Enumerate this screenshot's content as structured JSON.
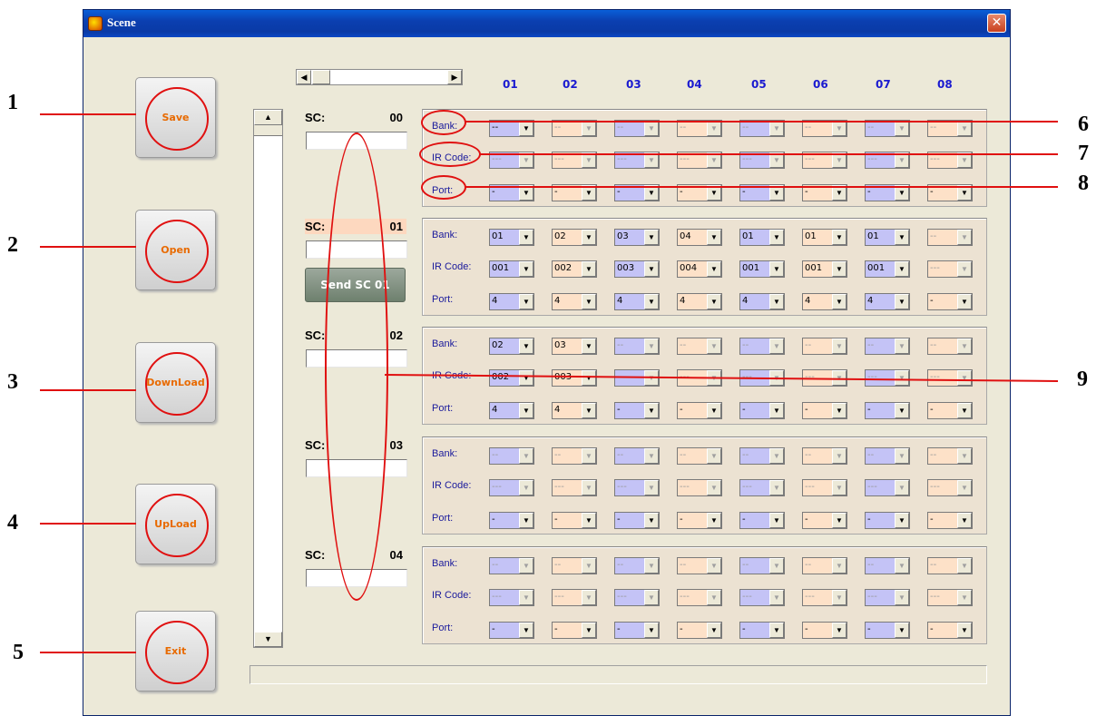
{
  "window": {
    "title": "Scene",
    "close_label": "✕"
  },
  "buttons": [
    {
      "id": "save",
      "label": "Save"
    },
    {
      "id": "open",
      "label": "Open"
    },
    {
      "id": "download",
      "label": "DownLoad"
    },
    {
      "id": "upload",
      "label": "UpLoad"
    },
    {
      "id": "exit",
      "label": "Exit"
    }
  ],
  "columns": [
    "01",
    "02",
    "03",
    "04",
    "05",
    "06",
    "07",
    "08"
  ],
  "row_labels": {
    "bank": "Bank:",
    "ir_code": "IR Code:",
    "port": "Port:"
  },
  "send_button": {
    "label": "Send SC 01"
  },
  "scenes": [
    {
      "sc_label": "SC:",
      "number": "00",
      "highlighted": false,
      "name": "",
      "bank": [
        "--",
        "--",
        "--",
        "--",
        "--",
        "--",
        "--",
        "--"
      ],
      "ir": [
        "---",
        "---",
        "---",
        "---",
        "---",
        "---",
        "---",
        "---"
      ],
      "port": [
        "-",
        "-",
        "-",
        "-",
        "-",
        "-",
        "-",
        "-"
      ]
    },
    {
      "sc_label": "SC:",
      "number": "01",
      "highlighted": true,
      "name": "",
      "bank": [
        "01",
        "02",
        "03",
        "04",
        "01",
        "01",
        "01",
        "--"
      ],
      "ir": [
        "001",
        "002",
        "003",
        "004",
        "001",
        "001",
        "001",
        "---"
      ],
      "port": [
        "4",
        "4",
        "4",
        "4",
        "4",
        "4",
        "4",
        "-"
      ]
    },
    {
      "sc_label": "SC:",
      "number": "02",
      "highlighted": false,
      "name": "",
      "bank": [
        "02",
        "03",
        "--",
        "--",
        "--",
        "--",
        "--",
        "--"
      ],
      "ir": [
        "002",
        "003",
        "---",
        "---",
        "---",
        "---",
        "---",
        "---"
      ],
      "port": [
        "4",
        "4",
        "-",
        "-",
        "-",
        "-",
        "-",
        "-"
      ]
    },
    {
      "sc_label": "SC:",
      "number": "03",
      "highlighted": false,
      "name": "",
      "bank": [
        "--",
        "--",
        "--",
        "--",
        "--",
        "--",
        "--",
        "--"
      ],
      "ir": [
        "---",
        "---",
        "---",
        "---",
        "---",
        "---",
        "---",
        "---"
      ],
      "port": [
        "-",
        "-",
        "-",
        "-",
        "-",
        "-",
        "-",
        "-"
      ]
    },
    {
      "sc_label": "SC:",
      "number": "04",
      "highlighted": false,
      "name": "",
      "bank": [
        "--",
        "--",
        "--",
        "--",
        "--",
        "--",
        "--",
        "--"
      ],
      "ir": [
        "---",
        "---",
        "---",
        "---",
        "---",
        "---",
        "---",
        "---"
      ],
      "port": [
        "-",
        "-",
        "-",
        "-",
        "-",
        "-",
        "-",
        "-"
      ]
    }
  ],
  "callouts": [
    "1",
    "2",
    "3",
    "4",
    "5",
    "6",
    "7",
    "8",
    "9"
  ],
  "colors": {
    "annotation": "#e01010",
    "column_header": "#1a1ad0",
    "button_text": "#e86a00"
  }
}
